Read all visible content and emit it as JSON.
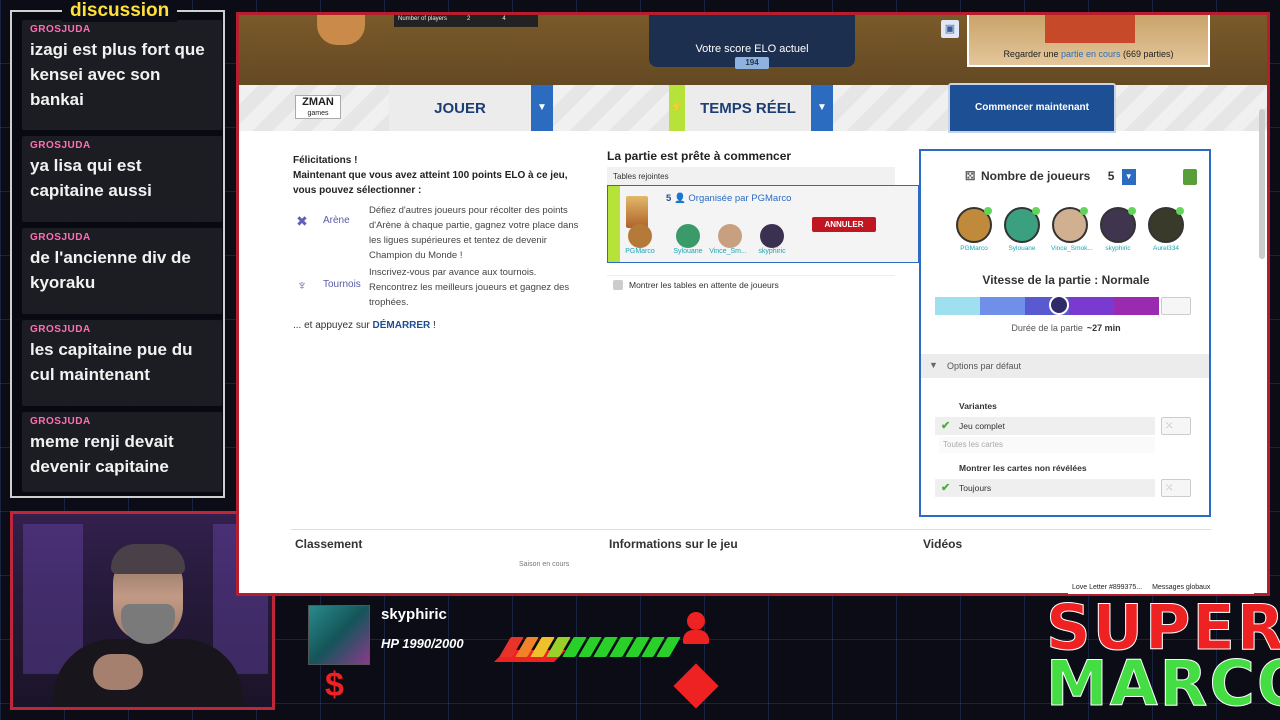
{
  "chat": {
    "title": "discussion",
    "messages": [
      {
        "user": "GROSJUDA",
        "text": "izagi est plus fort que kensei avec son bankai"
      },
      {
        "user": "GROSJUDA",
        "text": "ya lisa qui est capitaine aussi"
      },
      {
        "user": "GROSJUDA",
        "text": "de l'ancienne div de kyoraku"
      },
      {
        "user": "GROSJUDA",
        "text": "les capitaine pue du cul maintenant"
      },
      {
        "user": "GROSJUDA",
        "text": "meme renji devait devenir capitaine"
      }
    ]
  },
  "game": {
    "top": {
      "mini_table": [
        "Number of players",
        "2",
        "4"
      ],
      "score_label": "Votre score ELO actuel",
      "score_value": "194",
      "watch_prefix": "Regarder une ",
      "watch_link": "partie en cours",
      "watch_count": " (669 parties)"
    },
    "logo": {
      "line1": "ZMAN",
      "line2": "games"
    },
    "modes": {
      "play": "JOUER",
      "realtime": "TEMPS RÉEL",
      "start": "Commencer maintenant"
    },
    "intro": {
      "line1": "Félicitations !",
      "line2": "Maintenant que vous avez atteint 100 points ELO à ce jeu, vous pouvez sélectionner :",
      "features": [
        {
          "icon": "arena-icon",
          "name": "Arène",
          "desc": "Défiez d'autres joueurs pour récolter des points d'Arène à chaque partie, gagnez votre place dans les ligues supérieures et tentez de devenir Champion du Monde !"
        },
        {
          "icon": "trophy-icon",
          "name": "Tournois",
          "desc": "Inscrivez-vous par avance aux tournois. Rencontrez les meilleurs joueurs et gagnez des trophées."
        }
      ],
      "press_prefix": "... et appuyez sur ",
      "press_link": "DÉMARRER",
      "press_suffix": " !"
    },
    "ready": {
      "title": "La partie est prête à commencer",
      "tables_label": "Tables rejointes",
      "org_count": "5",
      "org_prefix": "Organisée par ",
      "org_name": "PGMarco",
      "cancel": "ANNULER",
      "players": [
        "PGMarco",
        "Sylouane",
        "Vince_Sm...",
        "skyphiric"
      ],
      "show_waiting": "Montrer les tables en attente de joueurs"
    },
    "settings": {
      "nplayers_label": "Nombre de joueurs",
      "nplayers_value": "5",
      "seats": [
        "PGMarco",
        "Sylouane",
        "Vince_Smok...",
        "skyphiric",
        "Aurel334"
      ],
      "speed_title": "Vitesse de la partie : Normale",
      "duration_label": "Durée de la partie",
      "duration_value": "~27 min",
      "options_header": "Options par défaut",
      "variants_title": "Variantes",
      "variant_value": "Jeu complet",
      "variant_sub": "Toutes les cartes",
      "reveal_title": "Montrer les cartes non révélées",
      "reveal_value": "Toujours"
    },
    "bottom": {
      "ranking": "Classement",
      "season": "Saison en cours",
      "info": "Informations sur le jeu",
      "videos": "Vidéos"
    },
    "ribbon": [
      "Love Letter #899375...",
      "Messages globaux"
    ]
  },
  "hud": {
    "name": "skyphiric",
    "hp": "HP 1990/2000",
    "currency": "$",
    "hp_fraction": 0.995,
    "colors": [
      "#e8322a",
      "#f0822a",
      "#f0c02a",
      "#9ad02a",
      "#2ad02a",
      "#2ad02a",
      "#2ad02a",
      "#2ad02a",
      "#2ad02a",
      "#2ad02a",
      "#2ad02a"
    ]
  },
  "brand": {
    "line1": "SUPER",
    "line2": "MARCO"
  }
}
